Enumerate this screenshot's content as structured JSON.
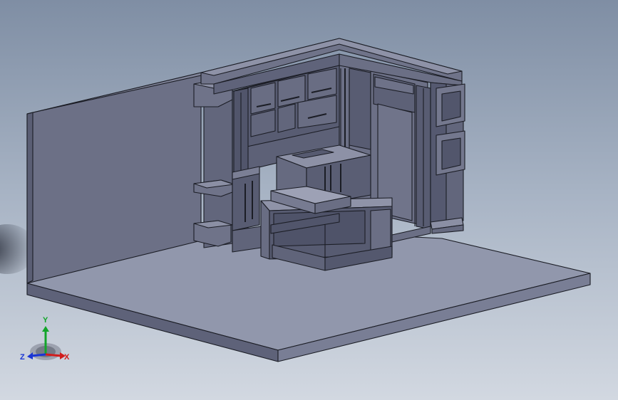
{
  "triad": {
    "x_label": "X",
    "y_label": "Y",
    "z_label": "Z",
    "x_color": "#d11d1d",
    "y_color": "#12a52a",
    "z_color": "#1a35d4"
  },
  "colors": {
    "background_top": "#7f8ea4",
    "background_bottom": "#d2d8e1",
    "model_edge": "#1b1d25",
    "floor_top": "#9197ac",
    "wall_face": "#6c7086",
    "cabinet_face": "#5d6177"
  }
}
